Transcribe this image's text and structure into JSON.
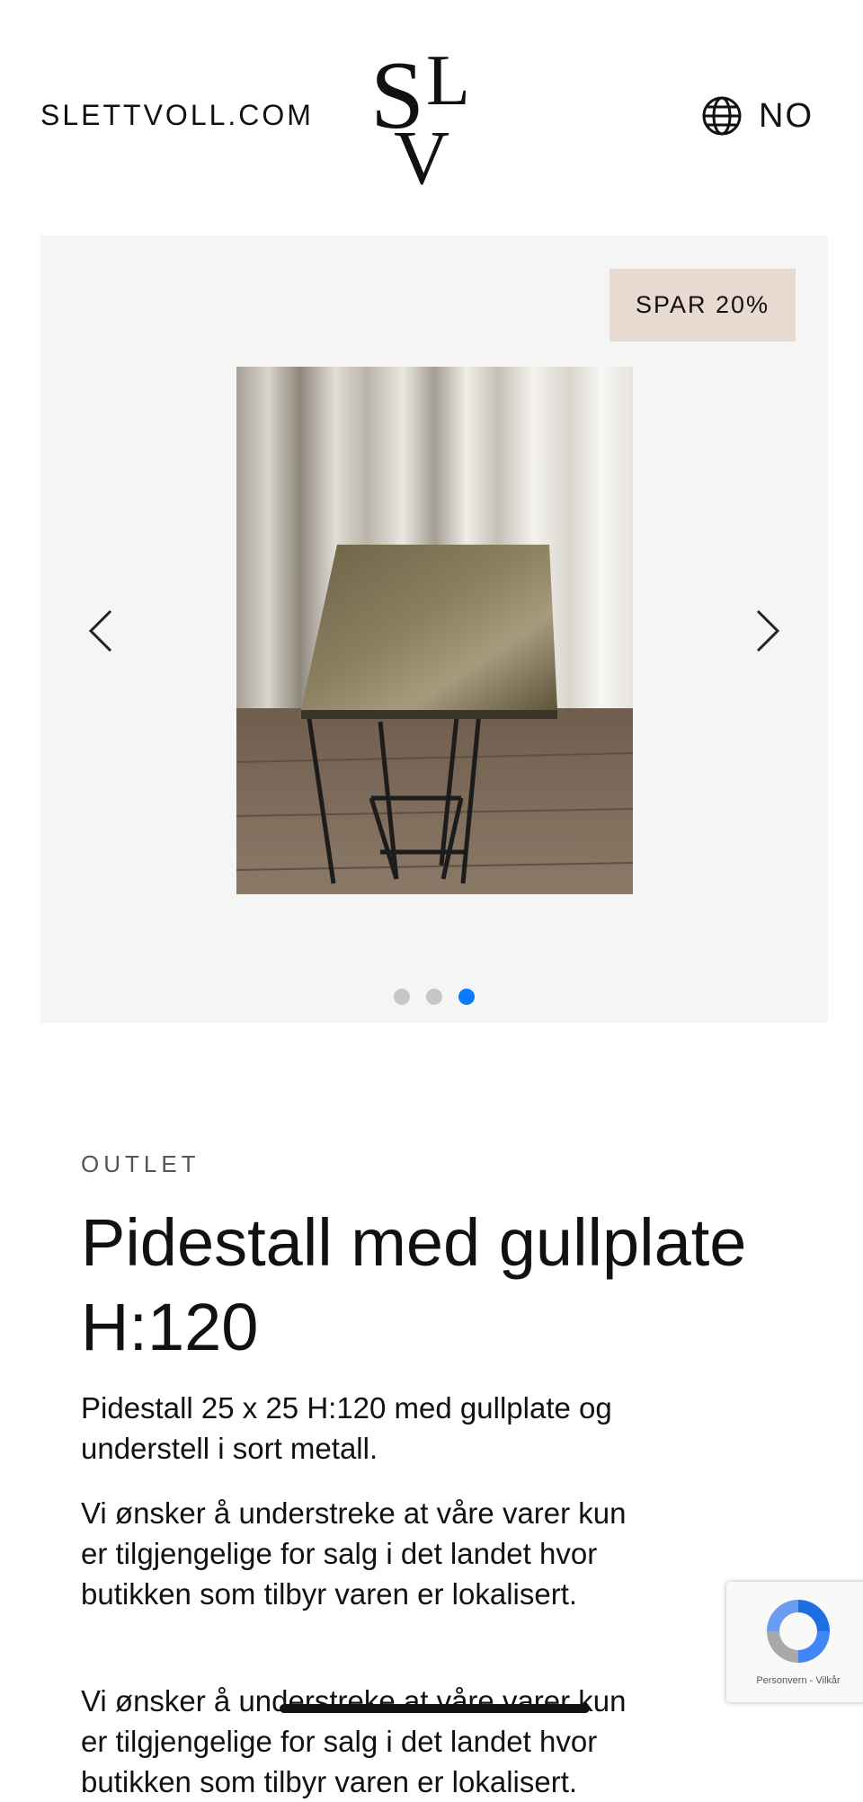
{
  "header": {
    "site_link": "SLETTVOLL.COM",
    "logo_letters": [
      "S",
      "L",
      "V"
    ],
    "language": "NO",
    "language_icon": "globe-icon"
  },
  "gallery": {
    "badge": "SPAR 20%",
    "prev_icon": "chevron-left-icon",
    "next_icon": "chevron-right-icon",
    "slide_count": 3,
    "active_slide": 3
  },
  "product": {
    "category": "OUTLET",
    "title": "Pidestall med gullplate H:120",
    "description_1": "Pidestall 25 x 25 H:120 med gullplate og understell i sort metall.",
    "description_2": "Vi ønsker å understreke at våre varer kun er tilgjengelige for salg i det landet hvor butikken som tilbyr varen er lokalisert.",
    "description_3": "Vi ønsker å understreke at våre varer kun er tilgjengelige for salg i det landet hvor butikken som tilbyr varen er lokalisert."
  },
  "recaptcha": {
    "privacy": "Personvern",
    "separator": " - ",
    "terms": "Vilkår"
  },
  "colors": {
    "badge_bg": "#e8d9d1",
    "gallery_bg": "#f5f5f5",
    "dot_active": "#0a7bff",
    "dot_inactive": "#c7c7c7"
  }
}
